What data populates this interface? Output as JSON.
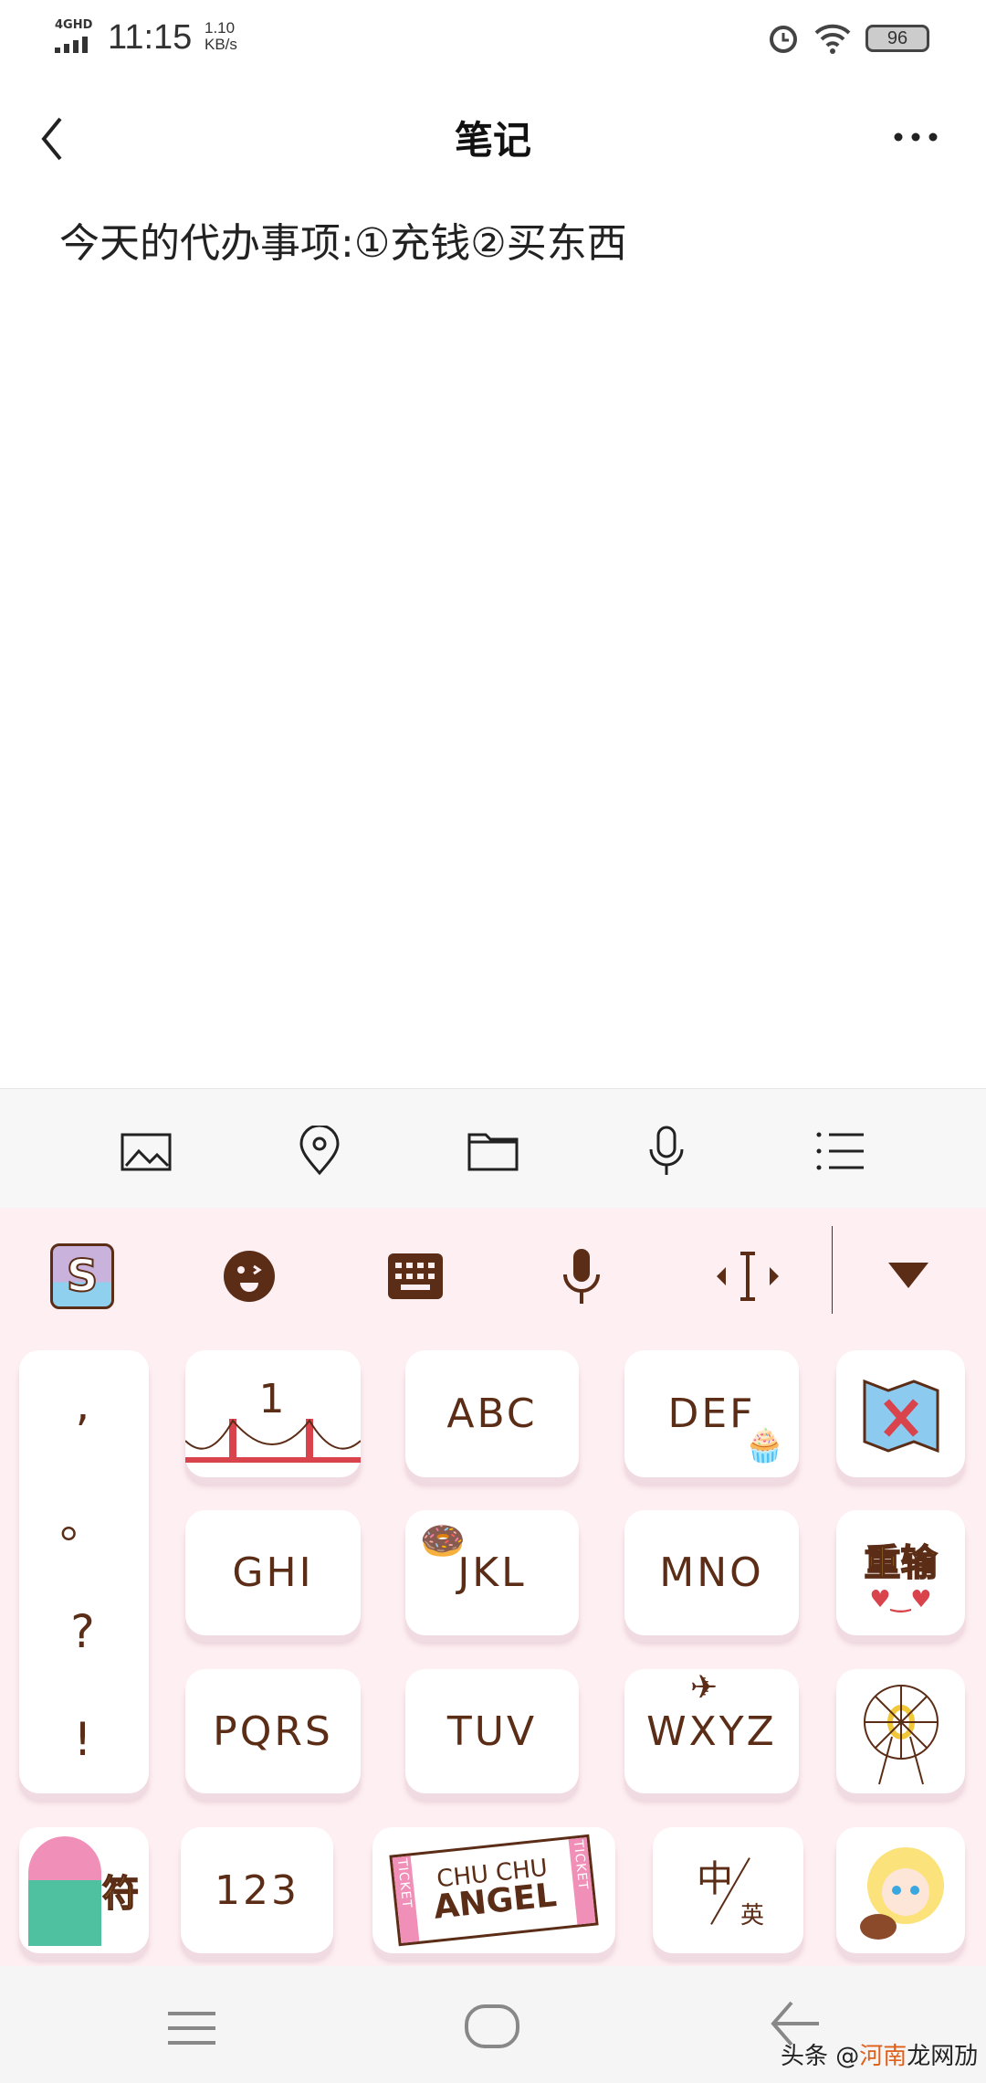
{
  "status_bar": {
    "network": "4GHD",
    "time": "11:15",
    "speed_value": "1.10",
    "speed_unit": "KB/s",
    "battery": "96"
  },
  "header": {
    "title": "笔记"
  },
  "note": {
    "content": "今天的代办事项:①充钱②买东西"
  },
  "toolbar": {
    "items": [
      "image-icon",
      "location-icon",
      "folder-icon",
      "microphone-icon",
      "list-icon"
    ]
  },
  "keyboard": {
    "accent": "#5b2d17",
    "background": "#fdeff2",
    "punctuation": [
      ",",
      "。",
      "?",
      "!"
    ],
    "rows": [
      [
        "1",
        "ABC",
        "DEF",
        ""
      ],
      [
        "GHI",
        "JKL",
        "MNO",
        "重输"
      ],
      [
        "PQRS",
        "TUV",
        "WXYZ",
        ""
      ]
    ],
    "bottom": {
      "symbol": "符",
      "numbers": "123",
      "space_line1": "CHU CHU",
      "space_line2": "ANGEL",
      "ticket": "TICKET",
      "lang_cn": "中",
      "lang_en": "英"
    }
  },
  "watermark": {
    "prefix": "头条 @",
    "highlight": "河南",
    "suffix": "龙网劢"
  }
}
